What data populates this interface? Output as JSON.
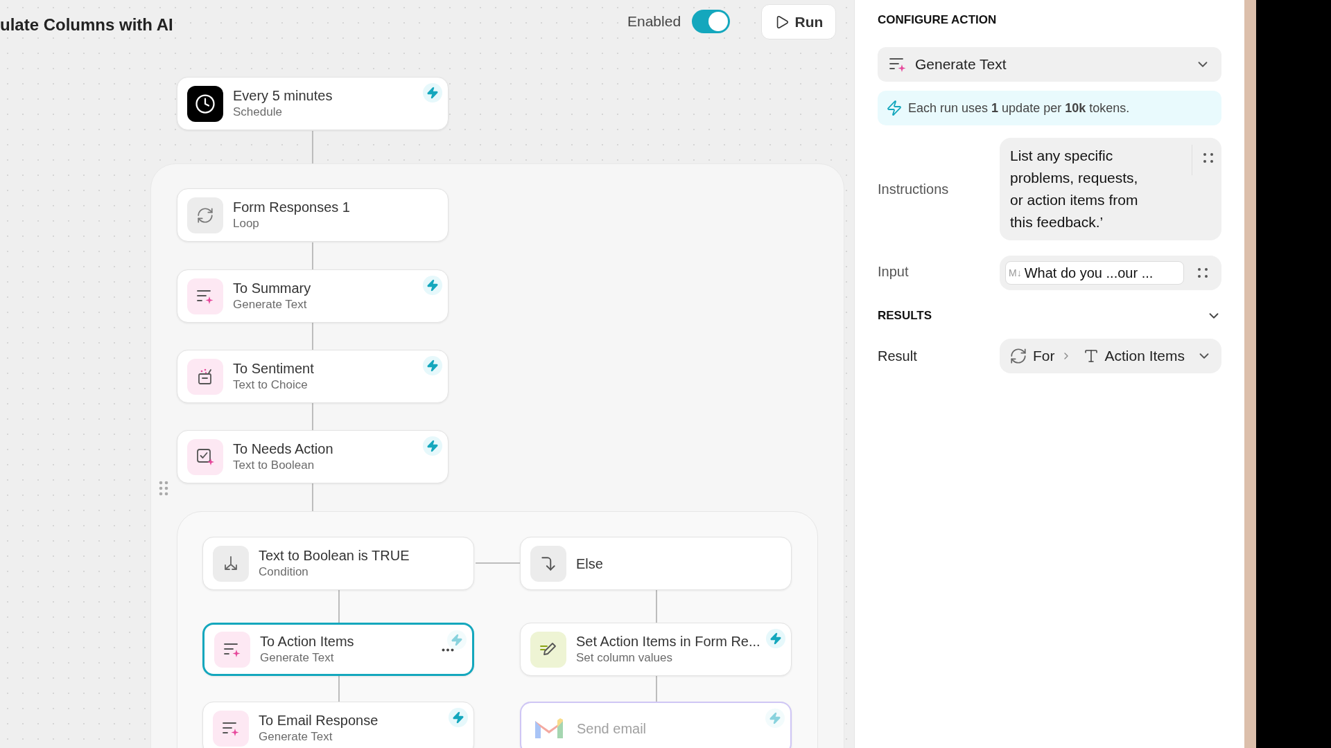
{
  "header": {
    "title": "ulate Columns with AI",
    "enabled_label": "Enabled",
    "enabled": true,
    "run_button": "Run"
  },
  "trigger": {
    "kind": "schedule",
    "title": "Every 5 minutes",
    "subtitle": "Schedule",
    "bolt": true,
    "selected": false,
    "disabled": false
  },
  "loop": {
    "node": {
      "kind": "loop",
      "title": "Form Responses 1",
      "subtitle": "Loop",
      "selected": false,
      "disabled": false
    },
    "steps": [
      {
        "kind": "generate_text",
        "title": "To Summary",
        "subtitle": "Generate Text",
        "bolt": true,
        "selected": false,
        "disabled": false
      },
      {
        "kind": "text_to_choice",
        "title": "To Sentiment",
        "subtitle": "Text to Choice",
        "bolt": true,
        "selected": false,
        "disabled": false
      },
      {
        "kind": "text_to_boolean",
        "title": "To Needs Action",
        "subtitle": "Text to Boolean",
        "bolt": true,
        "selected": false,
        "disabled": false
      }
    ],
    "branches": [
      {
        "node": {
          "kind": "condition",
          "title": "Text to Boolean is TRUE",
          "subtitle": "Condition",
          "selected": false,
          "disabled": false
        },
        "steps": [
          {
            "kind": "generate_text",
            "title": "To Action Items",
            "subtitle": "Generate Text",
            "bolt": true,
            "selected": true,
            "disabled": false
          },
          {
            "kind": "generate_text",
            "title": "To Email Response",
            "subtitle": "Generate Text",
            "bolt": true,
            "selected": false,
            "disabled": false
          }
        ]
      },
      {
        "node": {
          "kind": "else",
          "title": "Else",
          "selected": false,
          "disabled": false
        },
        "steps": [
          {
            "kind": "set_values",
            "title": "Set Action Items in Form Re...",
            "subtitle": "Set column values",
            "bolt": true,
            "selected": false,
            "disabled": false
          },
          {
            "kind": "send_email",
            "title": "Send email",
            "bolt": true,
            "selected": false,
            "disabled": true
          }
        ]
      }
    ]
  },
  "panel": {
    "heading": "CONFIGURE ACTION",
    "action_select": "Generate Text",
    "notice": "Each run uses **1** update per **10k** tokens.",
    "fields": [
      {
        "kind": "text",
        "label": "Instructions",
        "value": "List any specific problems, requests, or action items from this feedback.’"
      },
      {
        "kind": "token",
        "label": "Input",
        "badge": "M↓",
        "value": "What do you ...our ..."
      }
    ],
    "results_heading": "RESULTS",
    "result": {
      "label": "Result",
      "path": [
        "For",
        "Action Items"
      ]
    }
  }
}
